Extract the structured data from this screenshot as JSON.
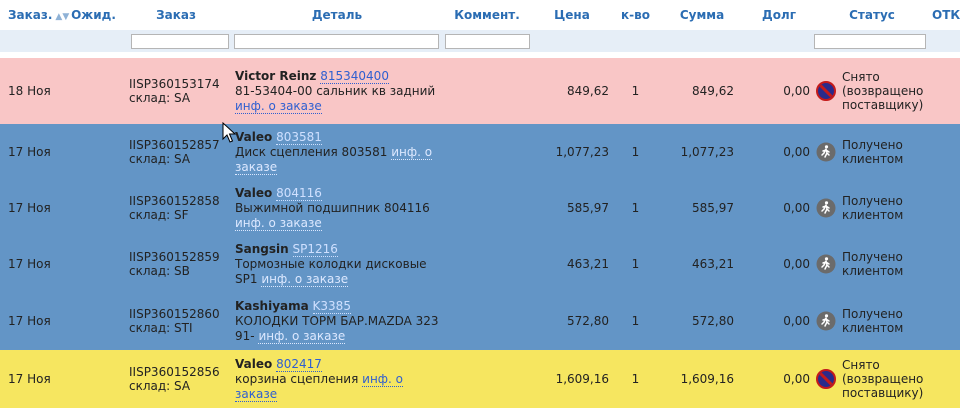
{
  "columns": {
    "order": "Заказ.",
    "waiting": "Ожид.",
    "order_no": "Заказ",
    "detail": "Деталь",
    "comment": "Коммент.",
    "price": "Цена",
    "qty": "к-во",
    "sum": "Сумма",
    "debt": "Долг",
    "status": "Статус",
    "refuse": "ОТКАЗ"
  },
  "sort_icon": "sort-arrows-icon",
  "row_colors": {
    "pink": "#f9c6c6",
    "blue": "#6395c6",
    "yellow": "#f6e660"
  },
  "rows": [
    {
      "date": "18 Ноя",
      "order_no": "IISP360153174",
      "warehouse": "склад: SA",
      "brand": "Victor Reinz",
      "article": "815340400",
      "description": "81-53404-00 сальник кв задний",
      "info_link": "инф. о заказе",
      "price": "849,62",
      "qty": "1",
      "sum": "849,62",
      "debt": "0,00",
      "status": "Снято (возвращено поставщику)",
      "status_icon": "cancelled-icon",
      "color": "pink"
    },
    {
      "date": "17 Ноя",
      "order_no": "IISP360152857",
      "warehouse": "склад: SA",
      "brand": "Valeo",
      "article": "803581",
      "description": "Диск сцепления 803581",
      "info_link": "инф. о заказе",
      "price": "1,077,23",
      "qty": "1",
      "sum": "1,077,23",
      "debt": "0,00",
      "status": "Получено клиентом",
      "status_icon": "walking-person-icon",
      "color": "blue"
    },
    {
      "date": "17 Ноя",
      "order_no": "IISP360152858",
      "warehouse": "склад: SF",
      "brand": "Valeo",
      "article": "804116",
      "description": "Выжимной подшипник 804116",
      "info_link": "инф. о заказе",
      "price": "585,97",
      "qty": "1",
      "sum": "585,97",
      "debt": "0,00",
      "status": "Получено клиентом",
      "status_icon": "walking-person-icon",
      "color": "blue"
    },
    {
      "date": "17 Ноя",
      "order_no": "IISP360152859",
      "warehouse": "склад: SB",
      "brand": "Sangsin",
      "article": "SP1216",
      "description": "Тормозные колодки дисковые SP1",
      "info_link": "инф. о заказе",
      "price": "463,21",
      "qty": "1",
      "sum": "463,21",
      "debt": "0,00",
      "status": "Получено клиентом",
      "status_icon": "walking-person-icon",
      "color": "blue"
    },
    {
      "date": "17 Ноя",
      "order_no": "IISP360152860",
      "warehouse": "склад: STI",
      "brand": "Kashiyama",
      "article": "K3385",
      "description": "КОЛОДКИ ТОРМ БАР.MAZDA 323 91-",
      "info_link": "инф. о заказе",
      "price": "572,80",
      "qty": "1",
      "sum": "572,80",
      "debt": "0,00",
      "status": "Получено клиентом",
      "status_icon": "walking-person-icon",
      "color": "blue"
    },
    {
      "date": "17 Ноя",
      "order_no": "IISP360152856",
      "warehouse": "склад: SA",
      "brand": "Valeo",
      "article": "802417",
      "description": "корзина сцепления",
      "info_link": "инф. о заказе",
      "price": "1,609,16",
      "qty": "1",
      "sum": "1,609,16",
      "debt": "0,00",
      "status": "Снято (возвращено поставщику)",
      "status_icon": "cancelled-icon",
      "color": "yellow"
    }
  ]
}
